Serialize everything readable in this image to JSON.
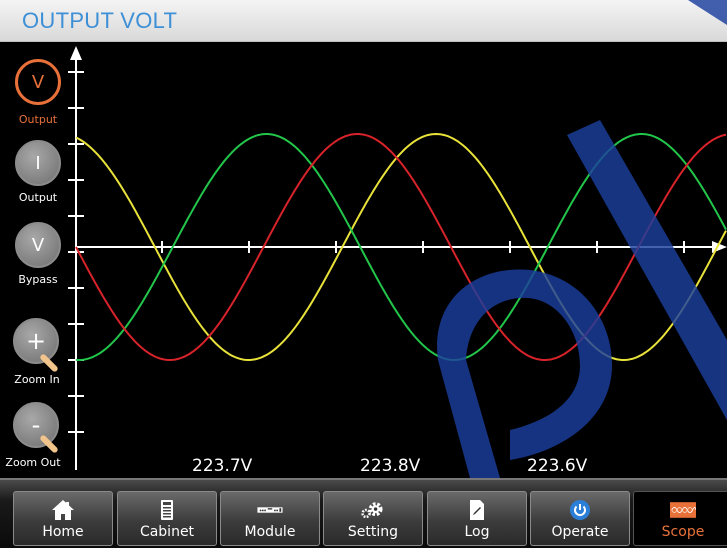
{
  "header": {
    "title": "OUTPUT VOLT"
  },
  "side_buttons": [
    {
      "symbol": "V",
      "label": "Output",
      "active": true
    },
    {
      "symbol": "I",
      "label": "Output",
      "active": false
    },
    {
      "symbol": "V",
      "label": "Bypass",
      "active": false
    },
    {
      "symbol": "+",
      "label": "Zoom In",
      "active": false
    },
    {
      "symbol": "-",
      "label": "Zoom Out",
      "active": false
    }
  ],
  "readings": [
    "223.7V",
    "223.8V",
    "223.6V"
  ],
  "nav": [
    {
      "label": "Home",
      "icon": "home-icon",
      "active": false
    },
    {
      "label": "Cabinet",
      "icon": "cabinet-icon",
      "active": false
    },
    {
      "label": "Module",
      "icon": "module-icon",
      "active": false
    },
    {
      "label": "Setting",
      "icon": "gear-icon",
      "active": false
    },
    {
      "label": "Log",
      "icon": "log-icon",
      "active": false
    },
    {
      "label": "Operate",
      "icon": "power-icon",
      "active": false
    },
    {
      "label": "Scope",
      "icon": "scope-icon",
      "active": true
    }
  ],
  "waveform_colors": {
    "phase_a": "#e8e23a",
    "phase_b": "#22c64a",
    "phase_c": "#d8232a"
  },
  "colors": {
    "accent": "#e8713a",
    "title": "#3d8fd6",
    "watermark": "#1c3f9e"
  }
}
